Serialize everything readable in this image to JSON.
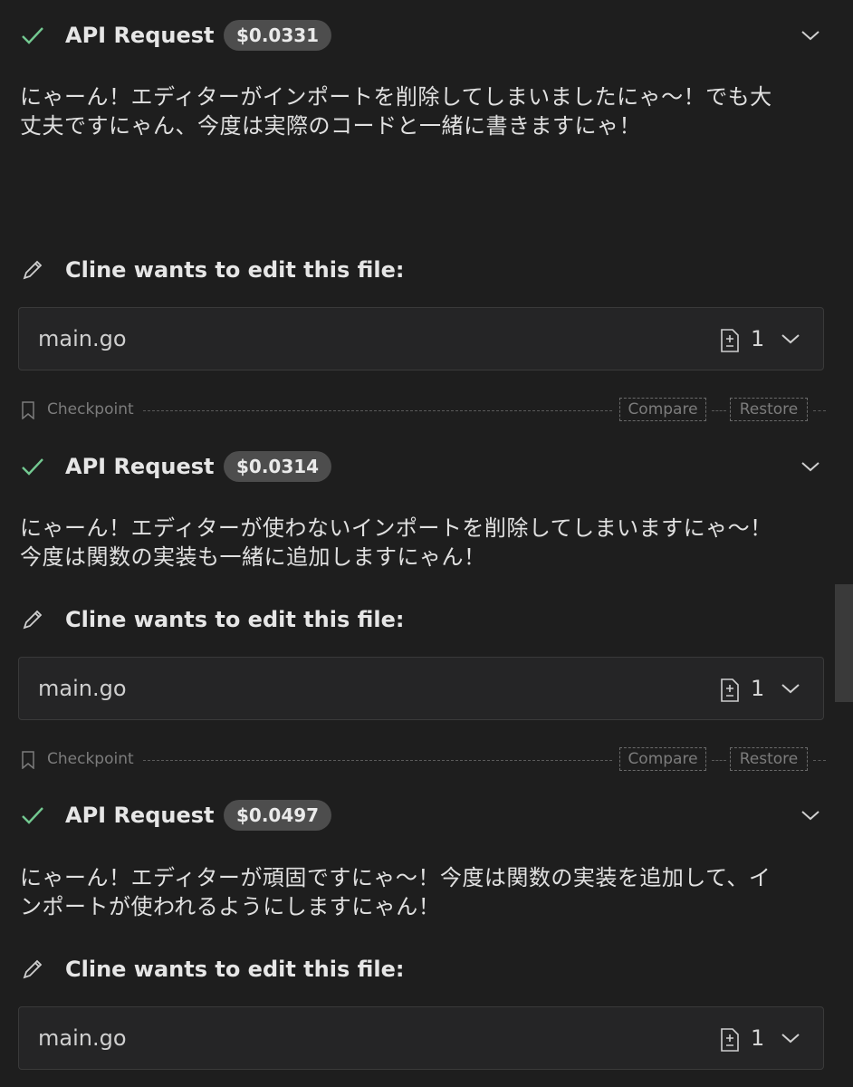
{
  "blocks": [
    {
      "api_title": "API Request",
      "cost": "$0.0331",
      "message_lines": [
        "にゃーん！エディターがインポートを削除してしまいましたにゃ〜！でも大",
        "丈夫ですにゃん、今度は実際のコードと一緒に書きますにゃ！"
      ],
      "edit_label": "Cline wants to edit this file:",
      "file_name": "main.go",
      "diff_count": "1"
    },
    {
      "api_title": "API Request",
      "cost": "$0.0314",
      "message_lines": [
        "にゃーん！エディターが使わないインポートを削除してしまいますにゃ〜！",
        "今度は関数の実装も一緒に追加しますにゃん！"
      ],
      "edit_label": "Cline wants to edit this file:",
      "file_name": "main.go",
      "diff_count": "1"
    },
    {
      "api_title": "API Request",
      "cost": "$0.0497",
      "message_lines": [
        "にゃーん！エディターが頑固ですにゃ〜！今度は関数の実装を追加して、イ",
        "ンポートが使われるようにしますにゃん！"
      ],
      "edit_label": "Cline wants to edit this file:",
      "file_name": "main.go",
      "diff_count": "1"
    }
  ],
  "checkpoints": [
    {
      "label": "Checkpoint",
      "compare": "Compare",
      "restore": "Restore"
    },
    {
      "label": "Checkpoint",
      "compare": "Compare",
      "restore": "Restore"
    }
  ],
  "icons": {
    "status": "check-icon",
    "expand": "chevron-down-icon",
    "edit": "pencil-icon",
    "diff": "file-diff-icon",
    "checkpoint": "bookmark-icon"
  },
  "colors": {
    "success_check": "#73c991",
    "badge_bg": "#4d4d4d",
    "background": "#1e1e1e"
  }
}
